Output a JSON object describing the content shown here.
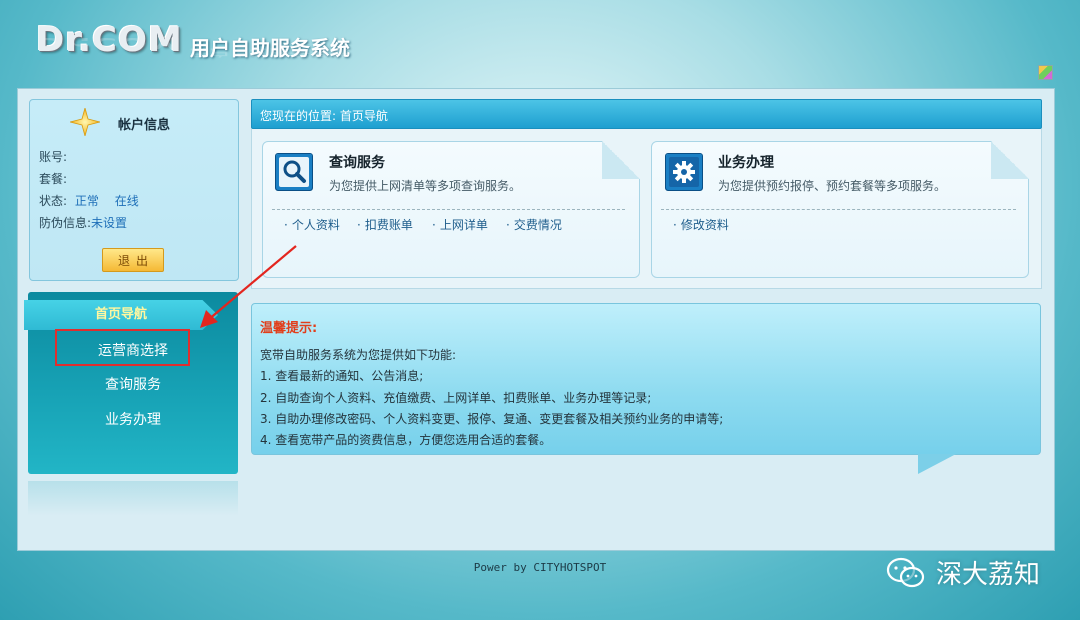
{
  "header": {
    "logo": "Dr.COM",
    "system_title": "用户自助服务系统"
  },
  "account": {
    "title": "帐户信息",
    "account_label": "账号:",
    "package_label": "套餐:",
    "status_label": "状态:",
    "status_value1": "正常",
    "status_value2": "在线",
    "antifraud_label": "防伪信息:",
    "antifraud_value": "未设置",
    "logout_label": "退出"
  },
  "nav": {
    "header": "首页导航",
    "items": [
      "运营商选择",
      "查询服务",
      "业务办理"
    ]
  },
  "breadcrumb": {
    "text": "您现在的位置: 首页导航"
  },
  "cards": {
    "query": {
      "title": "查询服务",
      "desc": "为您提供上网清单等多项查询服务。",
      "links": [
        "个人资料",
        "扣费账单",
        "上网详单",
        "交费情况"
      ]
    },
    "business": {
      "title": "业务办理",
      "desc": "为您提供预约报停、预约套餐等多项服务。",
      "links": [
        "修改资料"
      ]
    }
  },
  "tips": {
    "title": "温馨提示:",
    "lines": [
      "宽带自助服务系统为您提供如下功能:",
      "1. 查看最新的通知、公告消息;",
      "2. 自助查询个人资料、充值缴费、上网详单、扣费账单、业务办理等记录;",
      "3. 自助办理修改密码、个人资料变更、报停、复通、变更套餐及相关预约业务的申请等;",
      "4. 查看宽带产品的资费信息，方便您选用合适的套餐。"
    ]
  },
  "footer": {
    "text": "Power by CITYHOTSPOT"
  },
  "watermark": {
    "text": "深大荔知"
  }
}
